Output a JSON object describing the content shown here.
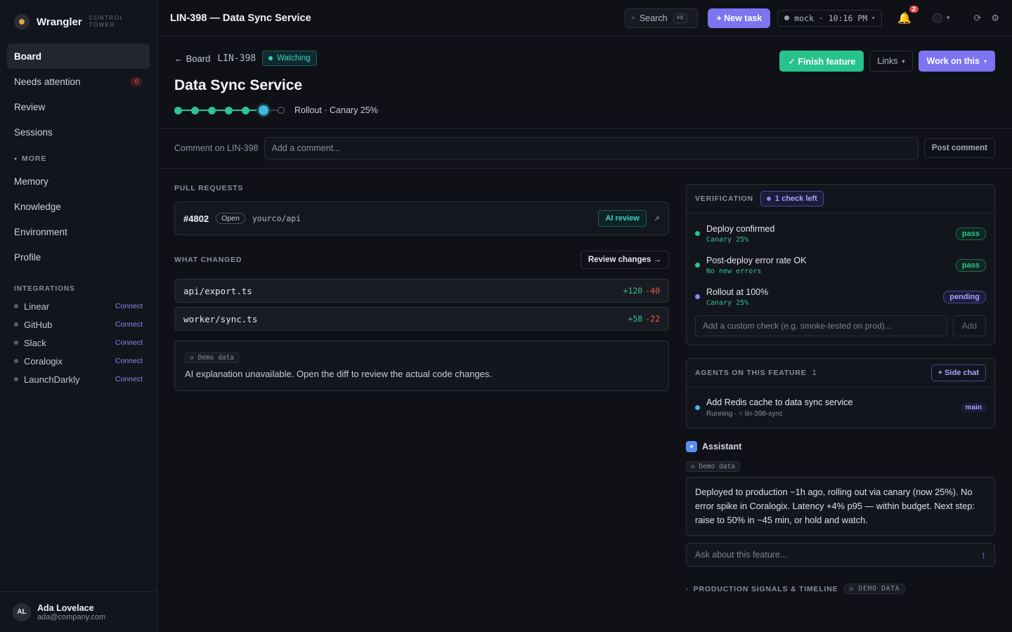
{
  "brand": {
    "name": "Wrangler",
    "subtitle": "CONTROL TOWER"
  },
  "sidebar": {
    "nav": [
      {
        "label": "Board",
        "active": true
      },
      {
        "label": "Needs attention",
        "badge": "6"
      },
      {
        "label": "Review"
      },
      {
        "label": "Sessions"
      }
    ],
    "more_label": "MORE",
    "more_items": [
      {
        "label": "Memory"
      },
      {
        "label": "Knowledge"
      },
      {
        "label": "Environment"
      },
      {
        "label": "Profile"
      }
    ],
    "integrations_label": "INTEGRATIONS",
    "integrations": [
      {
        "name": "Linear",
        "action": "Connect"
      },
      {
        "name": "GitHub",
        "action": "Connect"
      },
      {
        "name": "Slack",
        "action": "Connect"
      },
      {
        "name": "Coralogix",
        "action": "Connect"
      },
      {
        "name": "LaunchDarkly",
        "action": "Connect"
      }
    ],
    "user": {
      "initials": "AL",
      "name": "Ada Lovelace",
      "email": "ada@company.com"
    }
  },
  "topbar": {
    "title": "LIN-398 — Data Sync Service",
    "search_label": "Search",
    "search_shortcut": "⌘K",
    "new_task": "+ New task",
    "env": "mock · 10:16 PM",
    "notifications_count": "2"
  },
  "header": {
    "back": "← Board",
    "ticket_id": "LIN-398",
    "status": "Watching",
    "title": "Data Sync Service",
    "progress_label": "Rollout · Canary 25%",
    "finish_button": "✓ Finish feature",
    "links_button": "Links",
    "work_button": "Work on this"
  },
  "comment": {
    "label": "Comment on LIN-398",
    "placeholder": "Add a comment...",
    "post_button": "Post comment"
  },
  "pull_requests": {
    "label": "PULL REQUESTS",
    "items": [
      {
        "number": "#4802",
        "state": "Open",
        "repo": "yourco/api",
        "ai_review": "AI review"
      }
    ]
  },
  "what_changed": {
    "label": "WHAT CHANGED",
    "review_button": "Review changes →",
    "files": [
      {
        "name": "api/export.ts",
        "added": "+120",
        "removed": "-40"
      },
      {
        "name": "worker/sync.ts",
        "added": "+58",
        "removed": "-22"
      }
    ],
    "demo_chip": "◇ Demo data",
    "explanation": "AI explanation unavailable. Open the diff to review the actual code changes."
  },
  "verification": {
    "label": "VERIFICATION",
    "chip": "1 check left",
    "checks": [
      {
        "title": "Deploy confirmed",
        "sub": "Canary 25%",
        "status": "pass",
        "dot": "#2ec493"
      },
      {
        "title": "Post-deploy error rate OK",
        "sub": "No new errors",
        "status": "pass",
        "dot": "#2ec493"
      },
      {
        "title": "Rollout at 100%",
        "sub": "Canary 25%",
        "status": "pending",
        "dot": "#8b86f5"
      }
    ],
    "custom_placeholder": "Add a custom check (e.g. smoke-tested on prod)...",
    "add_button": "Add"
  },
  "agents": {
    "label": "AGENTS ON THIS FEATURE",
    "count": "1",
    "side_chat": "+ Side chat",
    "items": [
      {
        "title": "Add Redis cache to data sync service",
        "sub": "Running · ⑂ lin-398-sync",
        "branch": "main"
      }
    ]
  },
  "assistant": {
    "title": "Assistant",
    "demo_chip": "◇ Demo data",
    "message": "Deployed to production ~1h ago, rolling out via canary (now 25%). No error spike in Coralogix. Latency +4% p95 — within budget. Next step: raise to 50% in ~45 min, or hold and watch.",
    "ask_placeholder": "Ask about this feature..."
  },
  "signals": {
    "label": "PRODUCTION SIGNALS & TIMELINE",
    "chip": "◇ DEMO DATA"
  }
}
